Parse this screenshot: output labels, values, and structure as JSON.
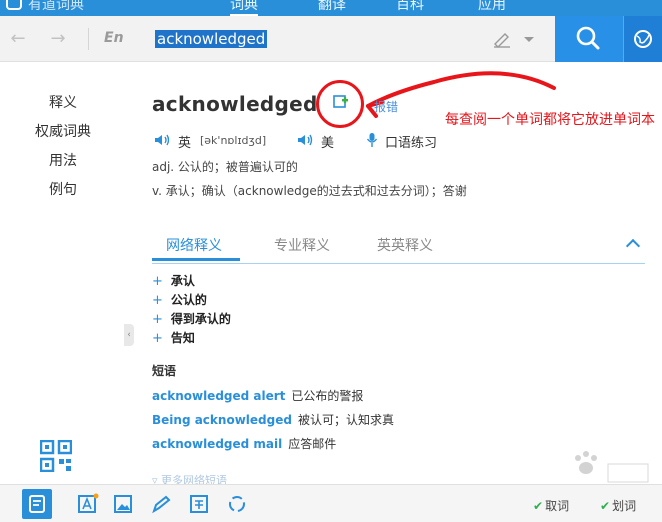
{
  "titlebar": {
    "app_title": "有道词典",
    "tabs": [
      "词典",
      "翻译",
      "百科",
      "应用"
    ]
  },
  "search": {
    "back": "←",
    "forward": "→",
    "lang": "En",
    "query": "acknowledged"
  },
  "sidebar": {
    "items": [
      "释义",
      "权威词典",
      "用法",
      "例句"
    ]
  },
  "entry": {
    "word": "acknowledged",
    "report_label": "报错",
    "annotation": "每查阅一个单词都将它放进单词本",
    "uk_label": "英",
    "uk_phonetic": "[ək'nɒlɪdʒd]",
    "us_label": "美",
    "practice_label": "口语练习",
    "definitions": [
      "adj. 公认的；被普遍认可的",
      "v. 承认；确认（acknowledge的过去式和过去分词）；答谢"
    ]
  },
  "tabs": [
    "网络释义",
    "专业释义",
    "英英释义"
  ],
  "meanings": [
    "承认",
    "公认的",
    "得到承认的",
    "告知"
  ],
  "phrases": {
    "heading": "短语",
    "items": [
      {
        "en": "acknowledged alert",
        "zh": "已公布的警报"
      },
      {
        "en": "Being acknowledged",
        "zh": "被认可；认知求真"
      },
      {
        "en": "acknowledged mail",
        "zh": "应答邮件"
      }
    ],
    "more": "更多网络短语"
  },
  "bottombar": {
    "fetch_label": "取词",
    "select_label": "划词"
  },
  "colors": {
    "accent": "#2a8fd9",
    "annotation": "#e8151b"
  }
}
